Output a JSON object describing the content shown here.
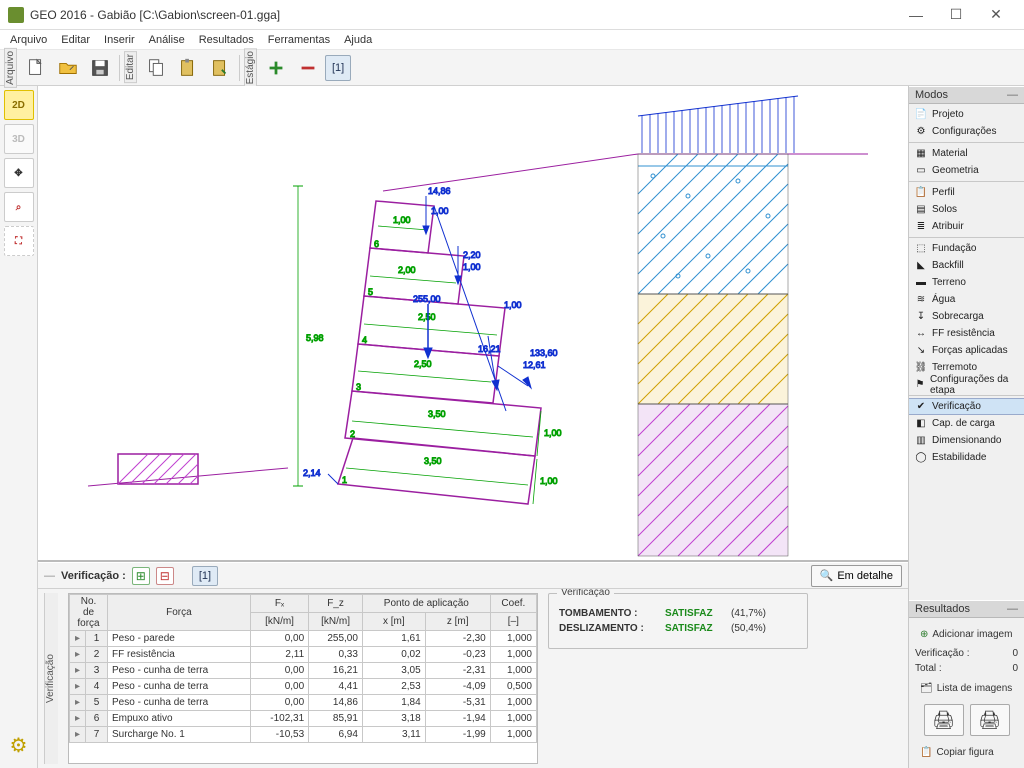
{
  "window": {
    "title": "GEO 2016 - Gabião [C:\\Gabion\\screen-01.gga]"
  },
  "menu": {
    "arquivo": "Arquivo",
    "editar": "Editar",
    "inserir": "Inserir",
    "analise": "Análise",
    "resultados": "Resultados",
    "ferramentas": "Ferramentas",
    "ajuda": "Ajuda"
  },
  "toolbar": {
    "tab_arquivo": "Arquivo",
    "tab_editar": "Editar",
    "tab_estagio": "Estágio",
    "stage_label": "[1]"
  },
  "left": {
    "b2d": "2D",
    "b3d": "3D"
  },
  "drawing": {
    "height_dim": "5,98",
    "w1": "1,00",
    "w2": "2,00",
    "w3": "2,50",
    "w4": "2,50",
    "w5": "3,50",
    "w6": "3,50",
    "fz": "255,00",
    "fz_top": "14,86",
    "fz_2": "1,00",
    "fz_3": "2,20",
    "fz_3b": "1,00",
    "fz_4": "1,00",
    "fz_5": "16,21",
    "fz_6": "12,61",
    "fz_side": "133,60",
    "h1": "1,00",
    "h2": "1,00",
    "off": "2,14",
    "row_labels": [
      "6",
      "5",
      "4",
      "3",
      "2",
      "1"
    ]
  },
  "bp": {
    "title": "Verificação :",
    "stage": "[1]",
    "detail": "Em detalhe",
    "side_label": "Verificação",
    "headers": {
      "no": "No.",
      "deforca": "de força",
      "forca": "Força",
      "fx": "Fₓ",
      "fz": "F_z",
      "unit": "[kN/m]",
      "ponto": "Ponto de aplicação",
      "x": "x [m]",
      "z": "z [m]",
      "coef": "Coef.",
      "coefu": "[–]"
    },
    "rows": [
      {
        "n": "1",
        "f": "Peso - parede",
        "fx": "0,00",
        "fz": "255,00",
        "x": "1,61",
        "z": "-2,30",
        "c": "1,000"
      },
      {
        "n": "2",
        "f": "FF resistência",
        "fx": "2,11",
        "fz": "0,33",
        "x": "0,02",
        "z": "-0,23",
        "c": "1,000"
      },
      {
        "n": "3",
        "f": "Peso - cunha de terra",
        "fx": "0,00",
        "fz": "16,21",
        "x": "3,05",
        "z": "-2,31",
        "c": "1,000"
      },
      {
        "n": "4",
        "f": "Peso - cunha de terra",
        "fx": "0,00",
        "fz": "4,41",
        "x": "2,53",
        "z": "-4,09",
        "c": "0,500"
      },
      {
        "n": "5",
        "f": "Peso - cunha de terra",
        "fx": "0,00",
        "fz": "14,86",
        "x": "1,84",
        "z": "-5,31",
        "c": "1,000"
      },
      {
        "n": "6",
        "f": "Empuxo ativo",
        "fx": "-102,31",
        "fz": "85,91",
        "x": "3,18",
        "z": "-1,94",
        "c": "1,000"
      },
      {
        "n": "7",
        "f": "Surcharge No. 1",
        "fx": "-10,53",
        "fz": "6,94",
        "x": "3,11",
        "z": "-1,99",
        "c": "1,000"
      }
    ],
    "verif": {
      "legend": "Verificação",
      "tomb_l": "TOMBAMENTO :",
      "tomb_s": "SATISFAZ",
      "tomb_p": "(41,7%)",
      "des_l": "DESLIZAMENTO :",
      "des_s": "SATISFAZ",
      "des_p": "(50,4%)"
    }
  },
  "right": {
    "modos": "Modos",
    "items": [
      {
        "i": "📄",
        "t": "Projeto"
      },
      {
        "i": "⚙",
        "t": "Configurações"
      },
      {
        "sep": true
      },
      {
        "i": "▦",
        "t": "Material"
      },
      {
        "i": "▭",
        "t": "Geometria"
      },
      {
        "sep": true
      },
      {
        "i": "📋",
        "t": "Perfil"
      },
      {
        "i": "▤",
        "t": "Solos"
      },
      {
        "i": "≣",
        "t": "Atribuir"
      },
      {
        "sep": true
      },
      {
        "i": "⬚",
        "t": "Fundação"
      },
      {
        "i": "◣",
        "t": "Backfill"
      },
      {
        "i": "▬",
        "t": "Terreno"
      },
      {
        "i": "≋",
        "t": "Água"
      },
      {
        "i": "↧",
        "t": "Sobrecarga"
      },
      {
        "i": "↔",
        "t": "FF resistência"
      },
      {
        "i": "↘",
        "t": "Forças aplicadas"
      },
      {
        "i": "⛓",
        "t": "Terremoto"
      },
      {
        "i": "⚑",
        "t": "Configurações da etapa"
      },
      {
        "sep": true
      },
      {
        "i": "✔",
        "t": "Verificação",
        "sel": true
      },
      {
        "i": "◧",
        "t": "Cap. de carga"
      },
      {
        "i": "▥",
        "t": "Dimensionando"
      },
      {
        "i": "◯",
        "t": "Estabilidade"
      }
    ],
    "resultados": "Resultados",
    "add_img": "Adicionar imagem",
    "verif_l": "Verificação :",
    "verif_v": "0",
    "total_l": "Total :",
    "total_v": "0",
    "list_img": "Lista de imagens",
    "copy_fig": "Copiar figura"
  }
}
